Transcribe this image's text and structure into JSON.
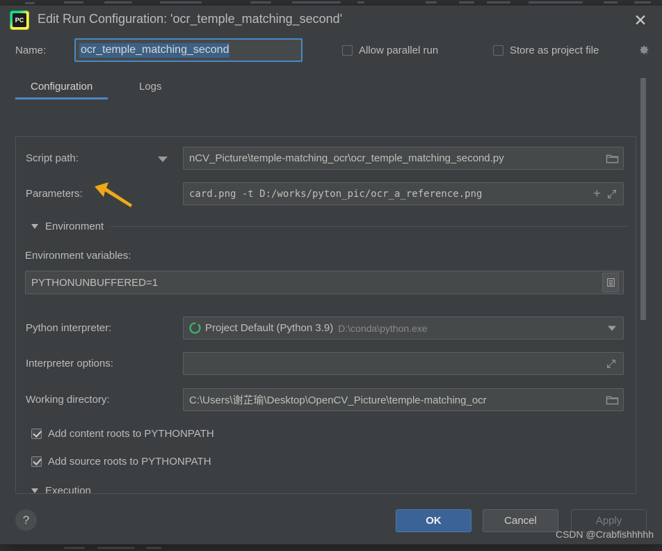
{
  "window": {
    "title": "Edit Run Configuration: 'ocr_temple_matching_second'",
    "app_icon": "pycharm-icon",
    "icon_text": "PC",
    "close_icon": "✕"
  },
  "name_row": {
    "label": "Name:",
    "value": "ocr_temple_matching_second",
    "placeholder": "Name",
    "allow_parallel_run": {
      "label": "Allow parallel run",
      "checked": false
    },
    "store_as_project_file": {
      "label": "Store as project file",
      "checked": false
    },
    "gear_icon": "gear-icon"
  },
  "tabs": [
    {
      "label": "Configuration",
      "active": true
    },
    {
      "label": "Logs",
      "active": false
    }
  ],
  "form": {
    "script_path": {
      "label": "Script path:",
      "value": "nCV_Picture\\temple-matching_ocr\\ocr_temple_matching_second.py",
      "browse_icon": "folder-icon",
      "dropdown_icon": "chevron-down-icon"
    },
    "parameters": {
      "label": "Parameters:",
      "value": "card.png -t D:/works/pyton_pic/ocr_a_reference.png",
      "insert_icon": "plus-icon",
      "expand_icon": "expand-icon"
    },
    "environment_section": {
      "label": "Environment",
      "expanded": true
    },
    "environment_variables": {
      "label": "Environment variables:",
      "value": "PYTHONUNBUFFERED=1",
      "edit_icon": "list-edit-icon"
    },
    "python_interpreter": {
      "label": "Python interpreter:",
      "value": "Project Default (Python 3.9)",
      "value_secondary": "D:\\conda\\python.exe",
      "status_icon": "python-env-circle-icon",
      "status_color": "#3cb46e",
      "dropdown_icon": "chevron-down-icon"
    },
    "interpreter_options": {
      "label": "Interpreter options:",
      "value": "",
      "expand_icon": "expand-icon"
    },
    "working_directory": {
      "label": "Working directory:",
      "value": "C:\\Users\\谢芷瑜\\Desktop\\OpenCV_Picture\\temple-matching_ocr",
      "browse_icon": "folder-icon"
    },
    "add_content_roots": {
      "label": "Add content roots to PYTHONPATH",
      "checked": true
    },
    "add_source_roots": {
      "label": "Add source roots to PYTHONPATH",
      "checked": true
    },
    "execution_section": {
      "label": "Execution",
      "expanded": true
    }
  },
  "footer": {
    "help_label": "?",
    "ok_label": "OK",
    "cancel_label": "Cancel",
    "apply_label": "Apply",
    "apply_enabled": false
  },
  "annotation": {
    "arrow_color": "#f0a818",
    "points_at": "Parameters:"
  },
  "watermark": "CSDN @Crabfishhhhh",
  "colors": {
    "dialog_bg": "#3c3f41",
    "field_bg": "#45494a",
    "accent_blue": "#4a88c7",
    "selection_blue": "#3d6185",
    "text": "#bbbbbb"
  }
}
